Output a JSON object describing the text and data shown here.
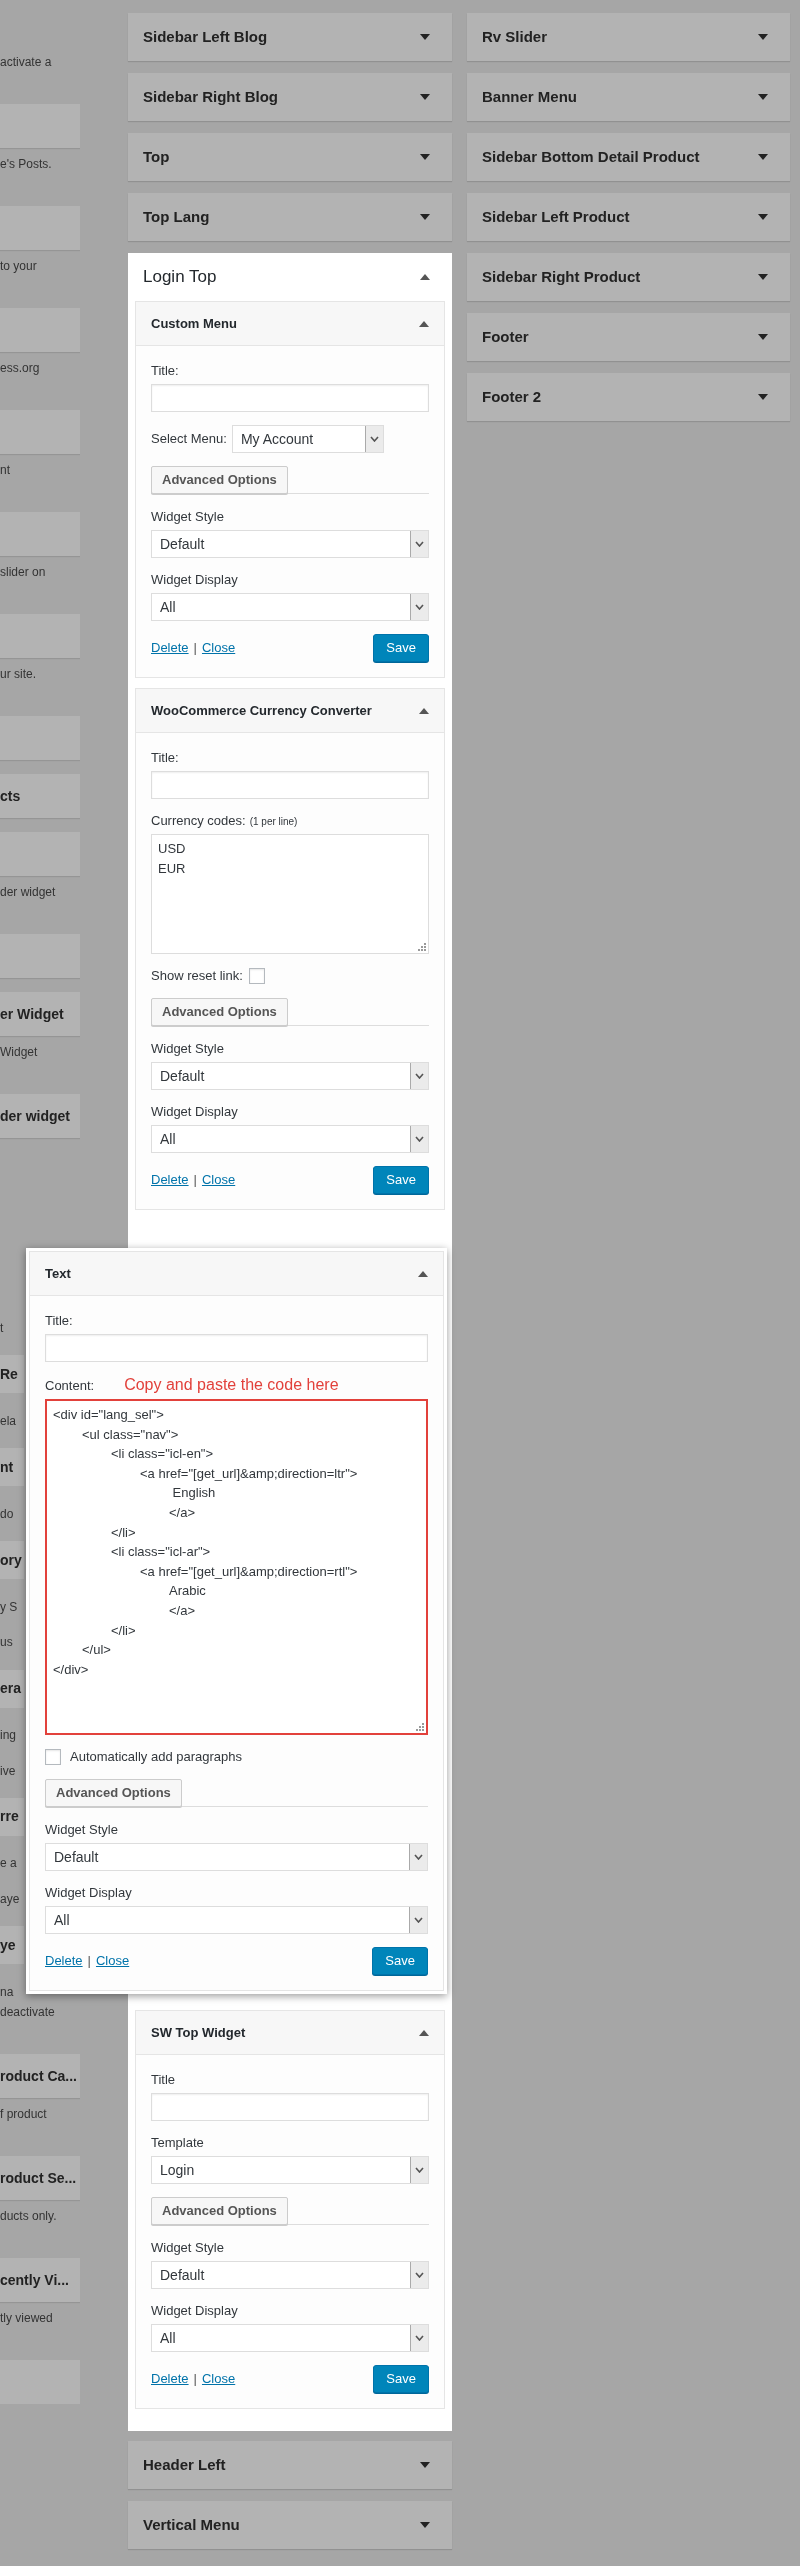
{
  "available_widgets": {
    "above_panel": [
      {
        "kind": "note",
        "text": "activate a"
      },
      {
        "kind": "tile"
      },
      {
        "kind": "note",
        "text": "e's Posts."
      },
      {
        "kind": "tile"
      },
      {
        "kind": "note",
        "text": "to your"
      },
      {
        "kind": "tile"
      },
      {
        "kind": "note",
        "text": "ess.org"
      },
      {
        "kind": "tile"
      },
      {
        "kind": "note",
        "text": "nt"
      },
      {
        "kind": "tile"
      },
      {
        "kind": "note",
        "text": "slider on"
      },
      {
        "kind": "tile"
      },
      {
        "kind": "note",
        "text": "ur site."
      },
      {
        "kind": "tile"
      },
      {
        "kind": "tile",
        "title": "cts"
      },
      {
        "kind": "tile"
      },
      {
        "kind": "note",
        "text": "der widget"
      },
      {
        "kind": "tile"
      },
      {
        "kind": "tile",
        "title": "er Widget"
      },
      {
        "kind": "note",
        "text": "Widget"
      },
      {
        "kind": "tile",
        "title": "der widget"
      }
    ],
    "beside_panel": [
      {
        "kind": "note",
        "text": "t"
      },
      {
        "kind": "tile",
        "title": "Re"
      },
      {
        "kind": "note",
        "text": "ela"
      },
      {
        "kind": "tile",
        "title": "nt"
      },
      {
        "kind": "note",
        "text": "do"
      },
      {
        "kind": "tile",
        "title": "ory"
      },
      {
        "kind": "note",
        "text": "y S"
      },
      {
        "kind": "note",
        "text": "us"
      },
      {
        "kind": "tile",
        "title": "era"
      },
      {
        "kind": "note",
        "text": "ing"
      },
      {
        "kind": "note",
        "text": "ive"
      },
      {
        "kind": "tile",
        "title": "rre"
      },
      {
        "kind": "note",
        "text": "e a"
      },
      {
        "kind": "note",
        "text": "aye"
      },
      {
        "kind": "tile",
        "title": "ye"
      },
      {
        "kind": "note",
        "text": "na"
      }
    ],
    "below_panel": [
      {
        "kind": "note",
        "text": "deactivate"
      },
      {
        "kind": "tile",
        "title": "roduct Ca..."
      },
      {
        "kind": "note",
        "text": "f product"
      },
      {
        "kind": "tile",
        "title": "roduct Se..."
      },
      {
        "kind": "note",
        "text": "ducts only."
      },
      {
        "kind": "tile",
        "title": "cently Vi..."
      },
      {
        "kind": "note",
        "text": "tly viewed"
      },
      {
        "kind": "tile"
      }
    ]
  },
  "sidebars_middle": [
    {
      "title": "Sidebar Left Blog",
      "expanded": false
    },
    {
      "title": "Sidebar Right Blog",
      "expanded": false
    },
    {
      "title": "Top",
      "expanded": false
    },
    {
      "title": "Top Lang",
      "expanded": false
    },
    {
      "title": "Login Top",
      "expanded": true,
      "widgets": [
        {
          "kind": "widget",
          "title": "Custom Menu",
          "expanded": true,
          "fields": [
            {
              "kind": "text",
              "label": "Title:"
            },
            {
              "kind": "inline-select",
              "label": "Select Menu:",
              "value": "My Account"
            },
            {
              "kind": "advanced",
              "label": "Advanced Options"
            },
            {
              "kind": "select",
              "label": "Widget Style",
              "value": "Default"
            },
            {
              "kind": "select",
              "label": "Widget Display",
              "value": "All"
            }
          ],
          "links": [
            "Delete",
            "Close"
          ],
          "separator": "|",
          "save": "Save"
        },
        {
          "kind": "widget",
          "title": "WooCommerce Currency Converter",
          "expanded": true,
          "fields": [
            {
              "kind": "text",
              "label": "Title:"
            },
            {
              "kind": "textarea",
              "label": "Currency codes:",
              "note": "(1 per line)",
              "highlighted": false,
              "lines": [
                "USD",
                "EUR"
              ]
            },
            {
              "kind": "trailing-checkbox",
              "label": "Show reset link:",
              "checked": false
            },
            {
              "kind": "advanced",
              "label": "Advanced Options"
            },
            {
              "kind": "select",
              "label": "Widget Style",
              "value": "Default"
            },
            {
              "kind": "select",
              "label": "Widget Display",
              "value": "All"
            }
          ],
          "links": [
            "Delete",
            "Close"
          ],
          "separator": "|",
          "save": "Save"
        },
        {
          "kind": "placeholder"
        },
        {
          "kind": "widget",
          "title": "SW Top Widget",
          "expanded": true,
          "fields": [
            {
              "kind": "text",
              "label": "Title"
            },
            {
              "kind": "select",
              "label": "Template",
              "value": "Login"
            },
            {
              "kind": "advanced",
              "label": "Advanced Options"
            },
            {
              "kind": "select",
              "label": "Widget Style",
              "value": "Default"
            },
            {
              "kind": "select",
              "label": "Widget Display",
              "value": "All"
            }
          ],
          "links": [
            "Delete",
            "Close"
          ],
          "separator": "|",
          "save": "Save"
        }
      ]
    },
    {
      "title": "Header Left",
      "expanded": false
    },
    {
      "title": "Vertical Menu",
      "expanded": false
    }
  ],
  "sidebars_right": [
    {
      "title": "Rv Slider",
      "expanded": false
    },
    {
      "title": "Banner Menu",
      "expanded": false
    },
    {
      "title": "Sidebar Bottom Detail Product",
      "expanded": false
    },
    {
      "title": "Sidebar Left Product",
      "expanded": false
    },
    {
      "title": "Sidebar Right Product",
      "expanded": false
    },
    {
      "title": "Footer",
      "expanded": false
    },
    {
      "title": "Footer 2",
      "expanded": false
    }
  ],
  "dragged_widget": {
    "kind": "widget",
    "title": "Text",
    "expanded": true,
    "fields": [
      {
        "kind": "text",
        "label": "Title:"
      },
      {
        "kind": "textarea",
        "label": "Content:",
        "annotation": "Copy and paste the code here",
        "highlighted": true,
        "lines": [
          "<div id=\"lang_sel\">",
          "\t<ul class=\"nav\">",
          "\t\t<li class=\"icl-en\">",
          "\t\t\t<a href=\"[get_url]&amp;direction=ltr\">",
          "\t\t\t\t English",
          "\t\t\t\t</a>",
          "\t\t</li>",
          "\t\t<li class=\"icl-ar\">",
          "\t\t\t<a href=\"[get_url]&amp;direction=rtl\">",
          "\t\t\t\tArabic",
          "\t\t\t\t</a>",
          "\t\t</li>",
          "\t</ul>",
          "</div>"
        ]
      },
      {
        "kind": "checkbox",
        "label": "Automatically add paragraphs",
        "checked": false
      },
      {
        "kind": "advanced",
        "label": "Advanced Options"
      },
      {
        "kind": "select",
        "label": "Widget Style",
        "value": "Default"
      },
      {
        "kind": "select",
        "label": "Widget Display",
        "value": "All"
      }
    ],
    "links": [
      "Delete",
      "Close"
    ],
    "separator": "|",
    "save": "Save"
  }
}
